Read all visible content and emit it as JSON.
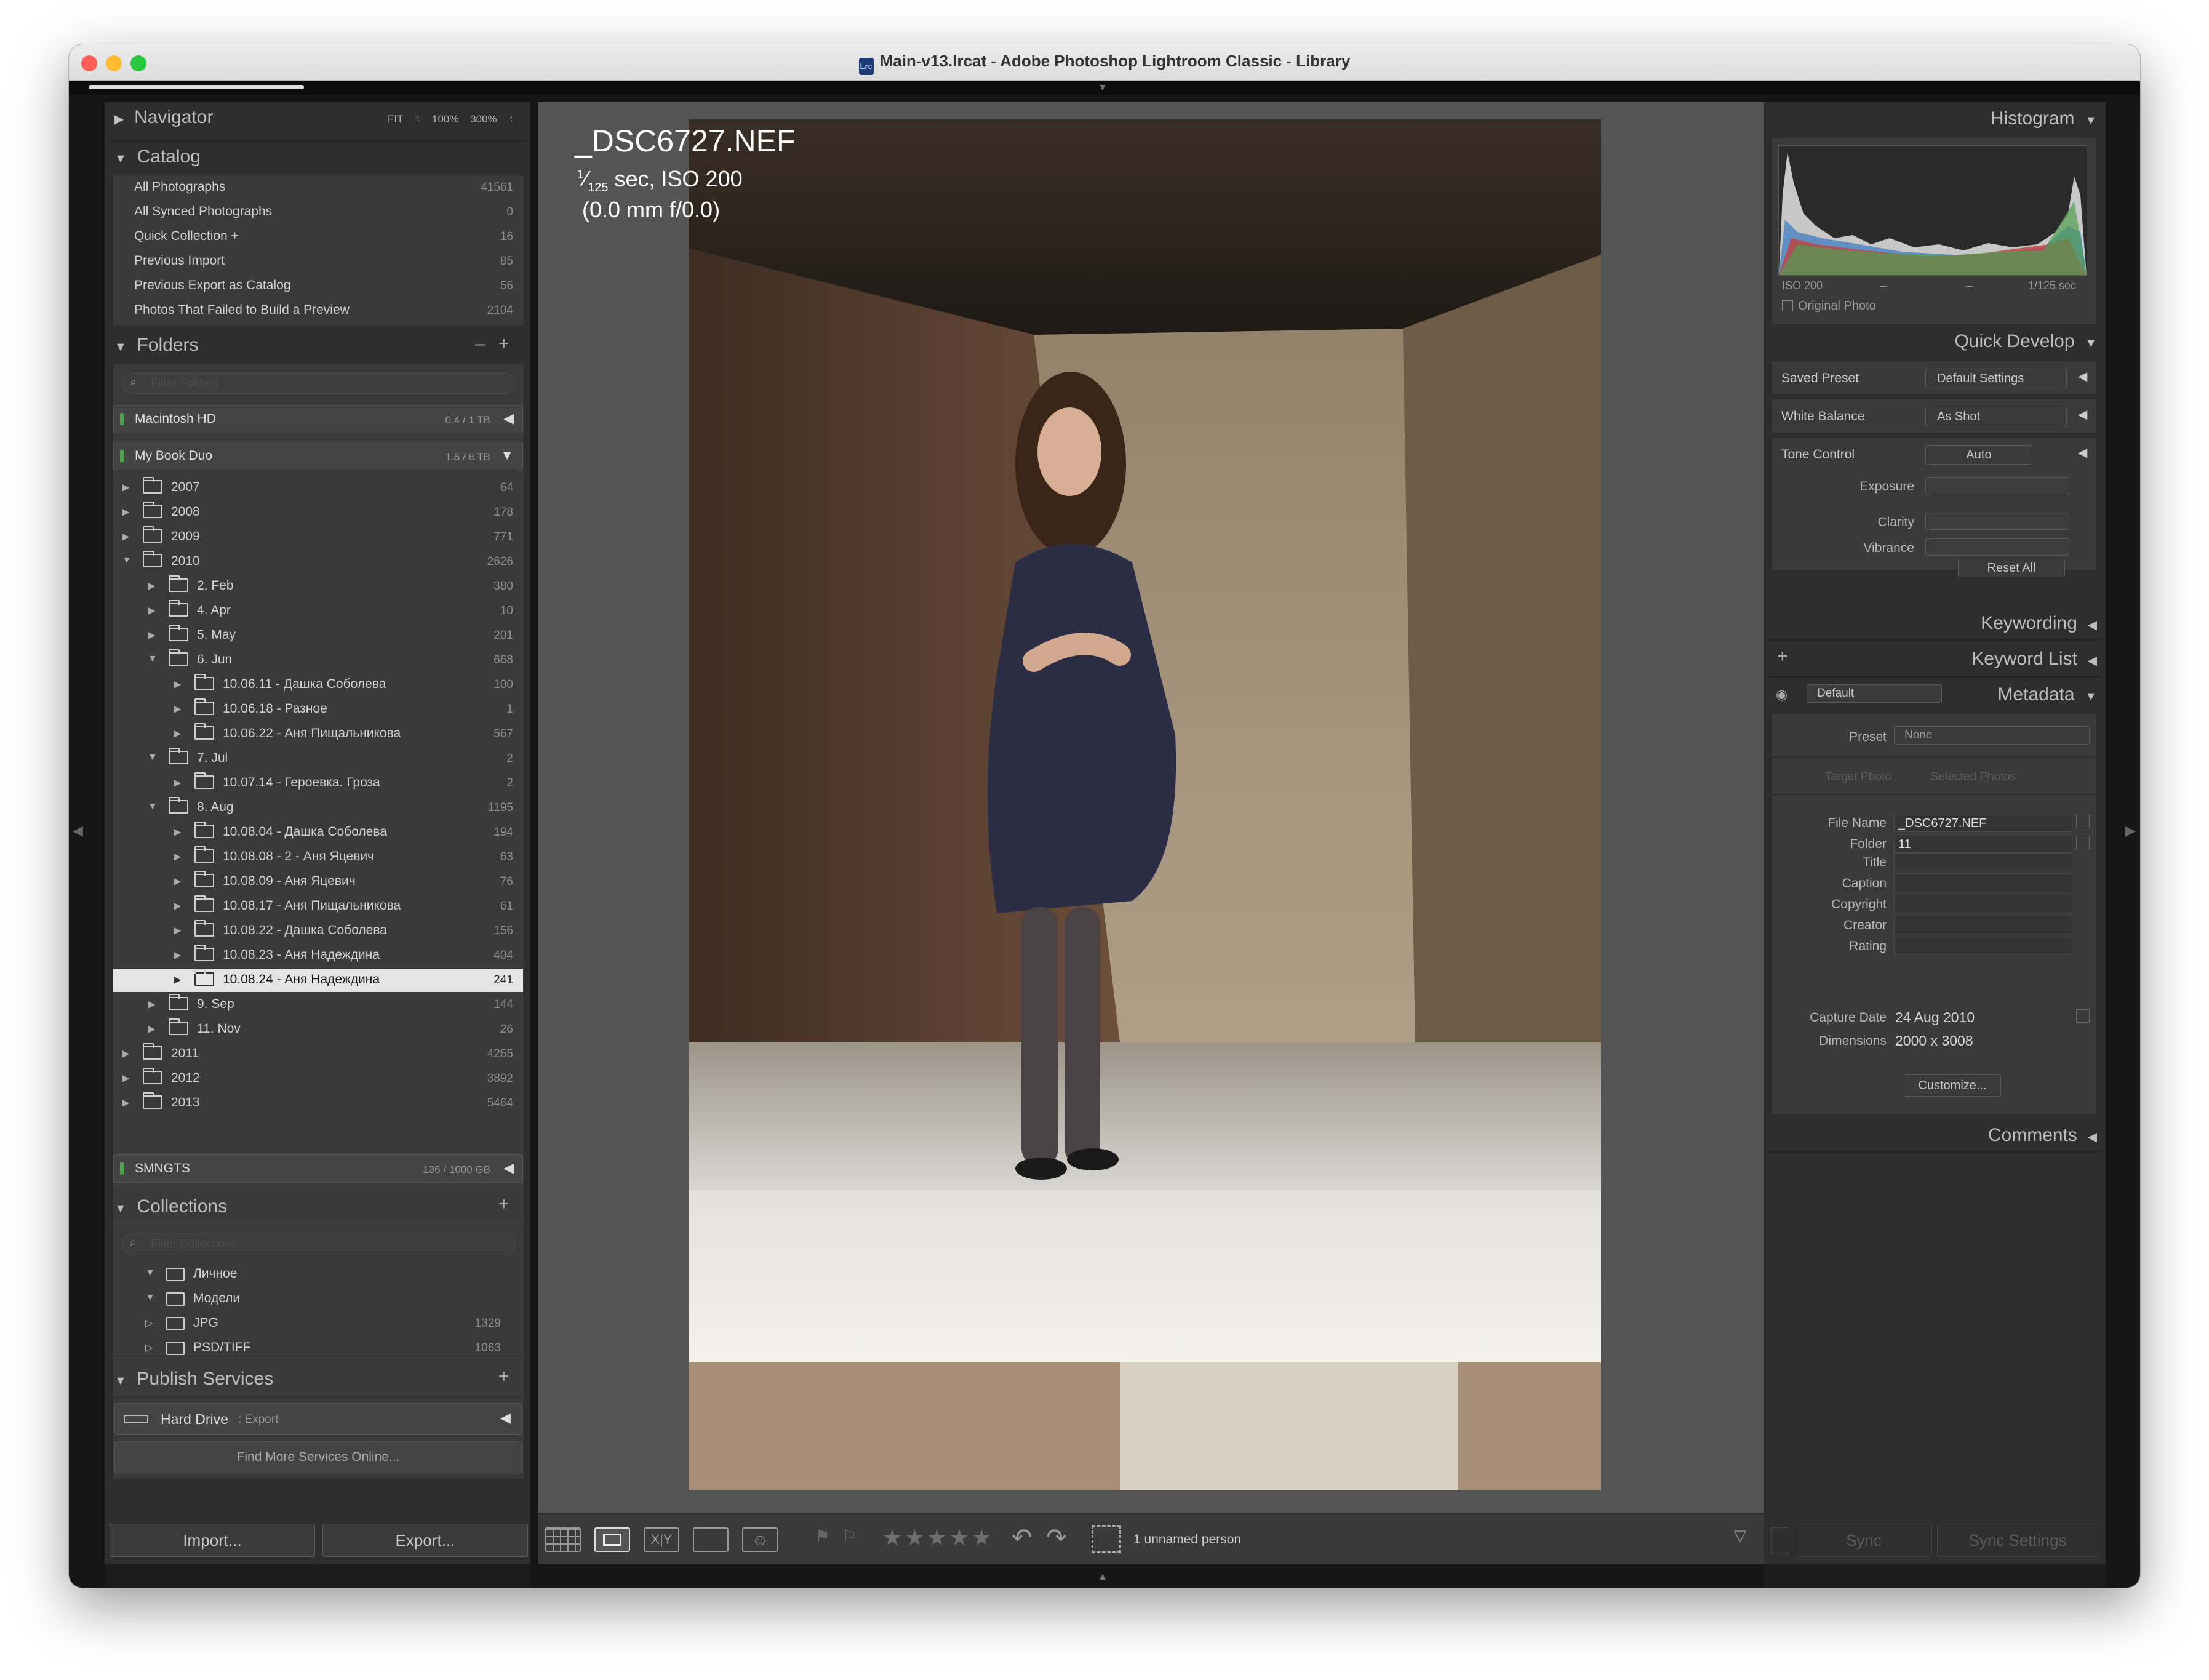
{
  "window": {
    "title": "Main-v13.lrcat - Adobe Photoshop Lightroom Classic - Library",
    "file_icon": "Lrc"
  },
  "navigator": {
    "label": "Navigator",
    "zoom": [
      "FIT ÷",
      "100%",
      "300%",
      "÷"
    ]
  },
  "catalog": {
    "label": "Catalog",
    "items": [
      {
        "label": "All Photographs",
        "count": "41561"
      },
      {
        "label": "All Synced Photographs",
        "count": "0"
      },
      {
        "label": "Quick Collection +",
        "count": "16"
      },
      {
        "label": "Previous Import",
        "count": "85"
      },
      {
        "label": "Previous Export as Catalog",
        "count": "56"
      },
      {
        "label": "Photos That Failed to Build a Preview",
        "count": "2104"
      }
    ]
  },
  "folders": {
    "label": "Folders",
    "minus": "–",
    "plus": "+",
    "filter_placeholder": "Filter Folders",
    "volumes": [
      {
        "label": "Macintosh HD",
        "size": "0.4 / 1 TB"
      },
      {
        "label": "My Book Duo",
        "size": "1.5 / 8 TB"
      },
      {
        "label": "SMNGTS",
        "size": "136 / 1000 GB"
      }
    ],
    "tree": [
      {
        "label": "2007",
        "count": "64"
      },
      {
        "label": "2008",
        "count": "178"
      },
      {
        "label": "2009",
        "count": "771"
      },
      {
        "label": "2010",
        "count": "2626"
      },
      {
        "label": "2. Feb",
        "count": "380"
      },
      {
        "label": "4. Apr",
        "count": "10"
      },
      {
        "label": "5. May",
        "count": "201"
      },
      {
        "label": "6. Jun",
        "count": "668"
      },
      {
        "label": "10.06.11 - Дашка Соболева",
        "count": "100"
      },
      {
        "label": "10.06.18 - Разное",
        "count": "1"
      },
      {
        "label": "10.06.22 - Аня Пищальникова",
        "count": "567"
      },
      {
        "label": "7. Jul",
        "count": "2"
      },
      {
        "label": "10.07.14 - Героевка. Гроза",
        "count": "2"
      },
      {
        "label": "8. Aug",
        "count": "1195"
      },
      {
        "label": "10.08.04 - Дашка Соболева",
        "count": "194"
      },
      {
        "label": "10.08.08 - 2 - Аня Яцевич",
        "count": "63"
      },
      {
        "label": "10.08.09 - Аня Яцевич",
        "count": "76"
      },
      {
        "label": "10.08.17 - Аня Пищальникова",
        "count": "61"
      },
      {
        "label": "10.08.22 - Дашка Соболева",
        "count": "156"
      },
      {
        "label": "10.08.23 - Аня Надеждина",
        "count": "404"
      },
      {
        "label": "10.08.24 - Аня Надеждина",
        "count": "241"
      },
      {
        "label": "9. Sep",
        "count": "144"
      },
      {
        "label": "11. Nov",
        "count": "26"
      },
      {
        "label": "2011",
        "count": "4265"
      },
      {
        "label": "2012",
        "count": "3892"
      },
      {
        "label": "2013",
        "count": "5464"
      }
    ]
  },
  "collections": {
    "label": "Collections",
    "plus": "+",
    "filter_placeholder": "Filter Collections",
    "items": [
      {
        "label": "Личное",
        "count": ""
      },
      {
        "label": "Модели",
        "count": ""
      },
      {
        "label": "JPG",
        "count": "1329"
      },
      {
        "label": "PSD/TIFF",
        "count": "1063"
      }
    ]
  },
  "publish": {
    "label": "Publish Services",
    "plus": "+",
    "hard_drive": "Hard Drive",
    "hard_drive_sub": ": Export",
    "find_more": "Find More Services Online..."
  },
  "bottom_left": {
    "import": "Import...",
    "export": "Export..."
  },
  "photo_info": {
    "filename": "_DSC6727.NEF",
    "shutter_num": "1",
    "shutter_den": "125",
    "exposure_rest": " sec, ISO 200",
    "lens": "(0.0 mm f/0.0)"
  },
  "toolbar": {
    "people": "1 unnamed person",
    "stars": "★★★★★"
  },
  "histogram": {
    "label": "Histogram",
    "iso": "ISO 200",
    "dash1": "–",
    "dash2": "–",
    "shutter": "1/125 sec",
    "original": "Original Photo"
  },
  "quick_develop": {
    "label": "Quick Develop",
    "saved_preset_label": "Saved Preset",
    "saved_preset_value": "Default Settings",
    "wb_label": "White Balance",
    "wb_value": "As Shot",
    "tone_label": "Tone Control",
    "tone_value": "Auto",
    "exposure": "Exposure",
    "clarity": "Clarity",
    "vibrance": "Vibrance",
    "reset": "Reset All"
  },
  "keywording": {
    "label": "Keywording"
  },
  "keyword_list": {
    "label": "Keyword List",
    "plus": "+"
  },
  "metadata": {
    "label": "Metadata",
    "preset_select": "Default",
    "preset_label": "Preset",
    "preset_value": "None",
    "target": "Target Photo",
    "selected": "Selected Photos",
    "fields": [
      {
        "label": "File Name",
        "value": "_DSC6727.NEF"
      },
      {
        "label": "Folder",
        "value": "11"
      },
      {
        "label": "Title",
        "value": ""
      },
      {
        "label": "Caption",
        "value": ""
      },
      {
        "label": "Copyright",
        "value": ""
      },
      {
        "label": "Creator",
        "value": ""
      },
      {
        "label": "Rating",
        "value": ""
      }
    ],
    "capture_label": "Capture Date",
    "capture_value": "24 Aug 2010",
    "dims_label": "Dimensions",
    "dims_value": "2000 x 3008",
    "customize": "Customize..."
  },
  "comments": {
    "label": "Comments"
  },
  "sync": {
    "sync": "Sync",
    "sync_settings": "Sync Settings"
  },
  "colors": {
    "bg": "#161616",
    "panel": "#2e2e2e",
    "center": "#545454",
    "selection": "#e4e4e4",
    "red": "#ff5f57",
    "yellow": "#febc2e",
    "green": "#28c840"
  }
}
